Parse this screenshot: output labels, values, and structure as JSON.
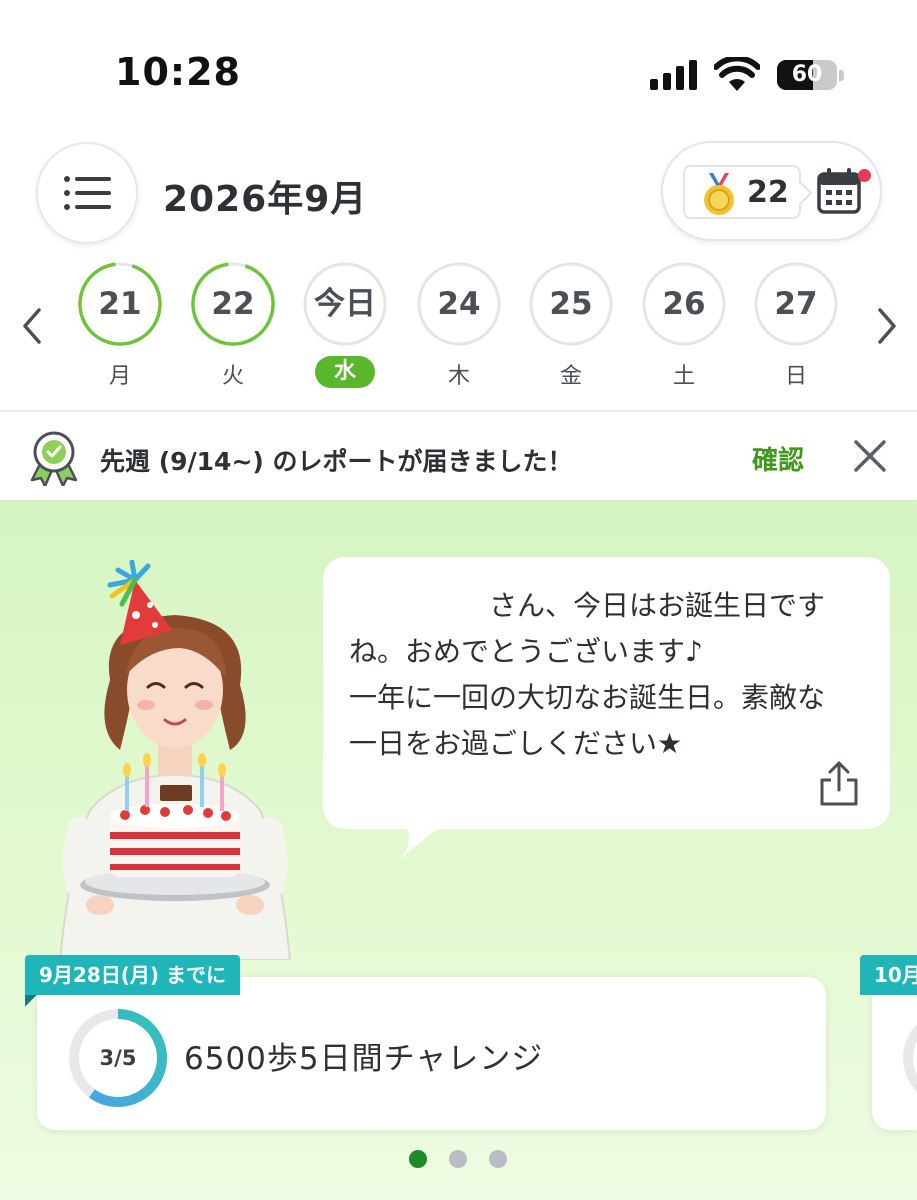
{
  "status_bar": {
    "time": "10:28",
    "battery_level": "60",
    "battery_percent": 60
  },
  "header": {
    "month_title": "2026年9月",
    "medal_count": "22",
    "menu_icon": "list-icon",
    "calendar_icon": "calendar-icon",
    "has_notification_dot": true
  },
  "week": {
    "days": [
      {
        "num": "21",
        "weekday": "月",
        "state": "achieved"
      },
      {
        "num": "22",
        "weekday": "火",
        "state": "achieved"
      },
      {
        "num": "今日",
        "weekday": "水",
        "state": "today"
      },
      {
        "num": "24",
        "weekday": "木",
        "state": "future"
      },
      {
        "num": "25",
        "weekday": "金",
        "state": "future"
      },
      {
        "num": "26",
        "weekday": "土",
        "state": "future"
      },
      {
        "num": "27",
        "weekday": "日",
        "state": "future"
      }
    ]
  },
  "report_banner": {
    "text": "先週 (9/14~) のレポートが届きました！",
    "confirm_label": "確認"
  },
  "message": {
    "text": "　　　　　さん、今日はお誕生日です\nね。おめでとうございます♪\n一年に一回の大切なお誕生日。素敵な\n一日をお過ごしください★"
  },
  "challenges": [
    {
      "deadline": "9月28日(月) までに",
      "progress_text": "3/5",
      "progress": 0.6,
      "title": "6500歩5日間チャレンジ"
    },
    {
      "deadline": "10月"
    }
  ],
  "pager": {
    "count": 3,
    "active": 0
  },
  "colors": {
    "accent_green": "#5ab62a",
    "link_green": "#3f9a1b",
    "teal": "#20b6b9",
    "background_green": "#d6f5c3"
  }
}
